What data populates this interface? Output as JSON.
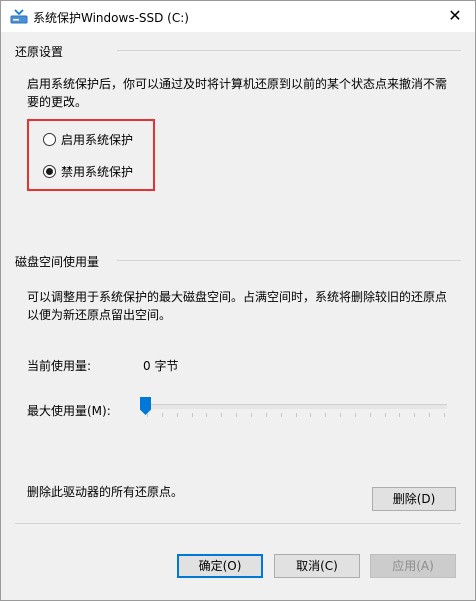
{
  "window": {
    "title": "系统保护Windows-SSD (C:)",
    "close_label": "✕"
  },
  "restore": {
    "section_title": "还原设置",
    "description": "启用系统保护后，你可以通过及时将计算机还原到以前的某个状态点来撤消不需要的更改。",
    "options": [
      {
        "label": "启用系统保护",
        "checked": false
      },
      {
        "label": "禁用系统保护",
        "checked": true
      }
    ]
  },
  "disk": {
    "section_title": "磁盘空间使用量",
    "description": "可以调整用于系统保护的最大磁盘空间。占满空间时，系统将删除较旧的还原点以便为新还原点留出空间。",
    "current_usage_label": "当前使用量:",
    "current_usage_value": "0 字节",
    "max_usage_label": "最大使用量(M):",
    "max_usage_fraction": 0.0
  },
  "delete": {
    "description": "删除此驱动器的所有还原点。",
    "button_label": "删除(D)"
  },
  "footer": {
    "ok_label": "确定(O)",
    "cancel_label": "取消(C)",
    "apply_label": "应用(A)"
  },
  "colors": {
    "accent": "#0078d7",
    "highlight_box": "#e53333"
  }
}
